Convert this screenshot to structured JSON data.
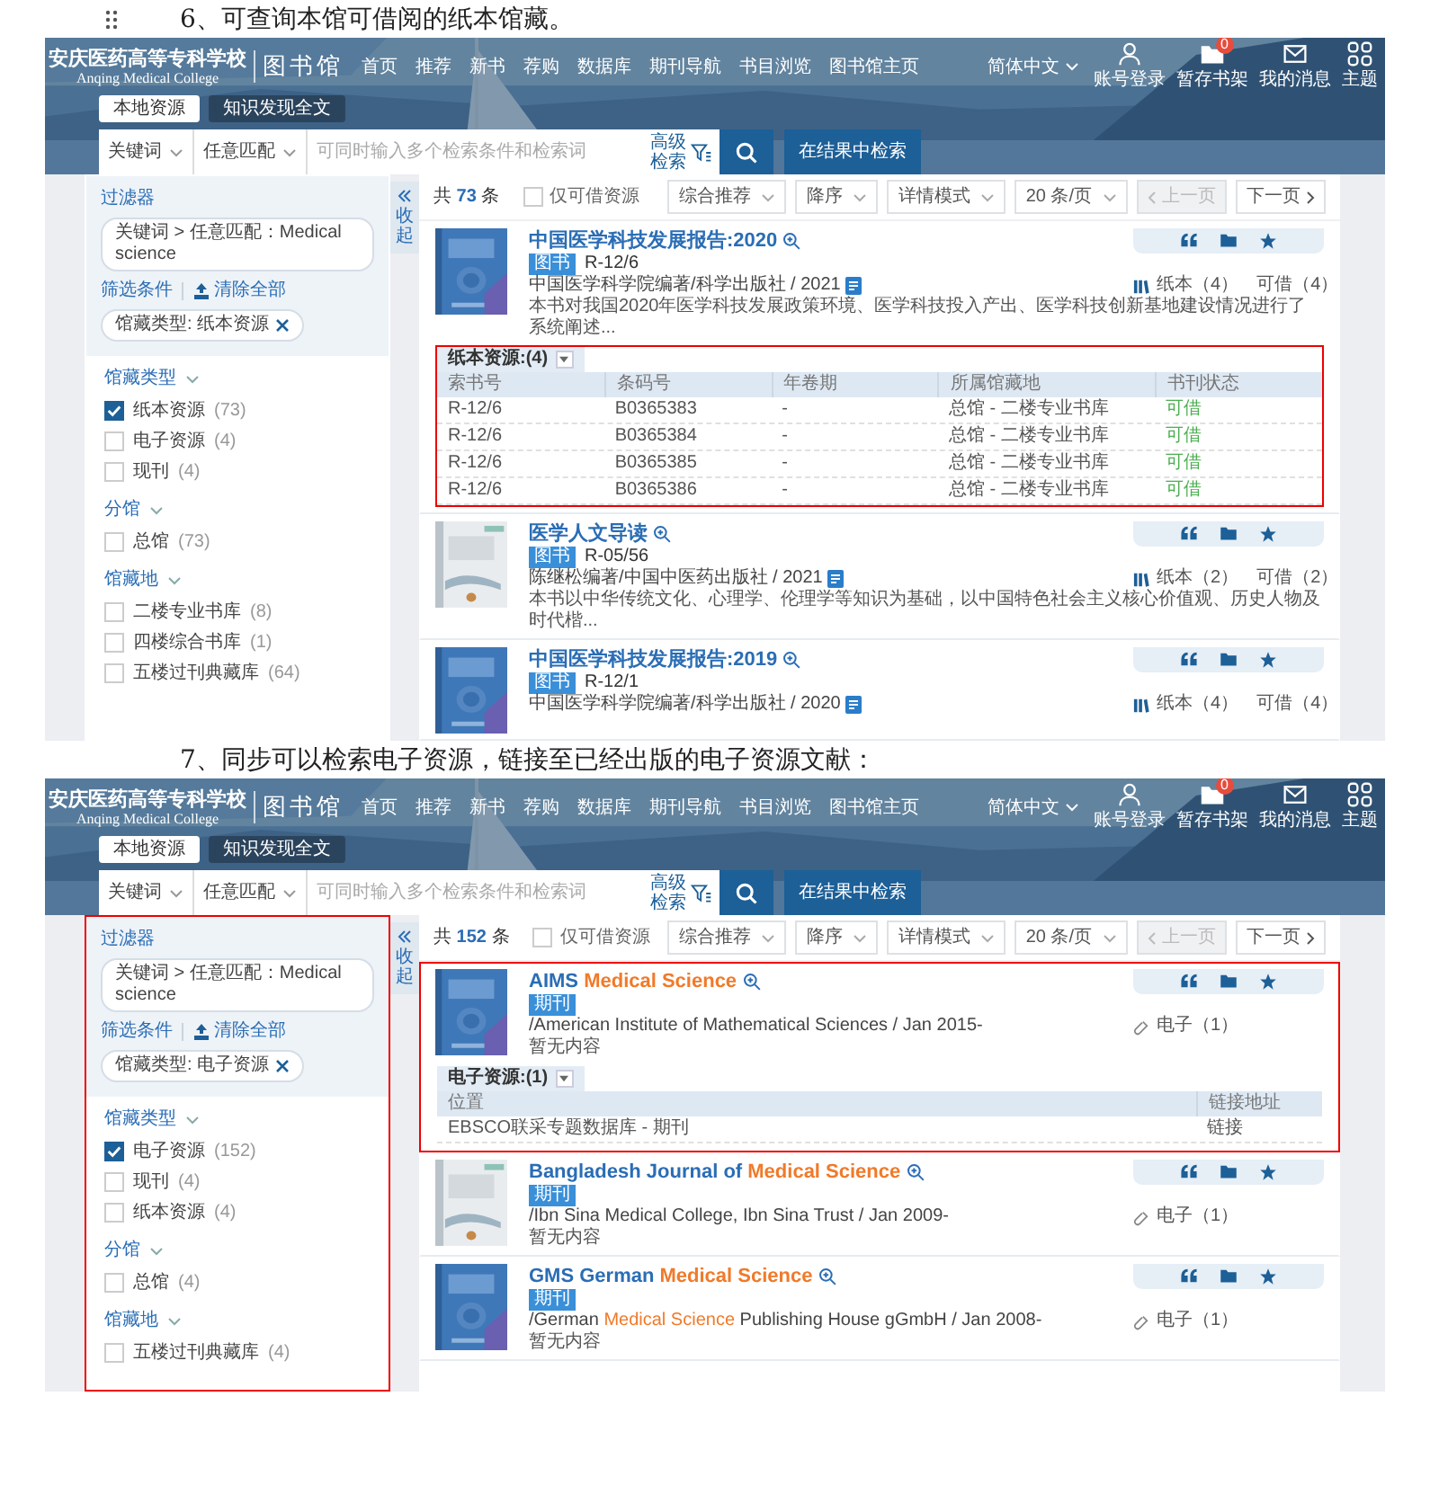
{
  "steps": [
    {
      "caption": "6、可查询本馆可借阅的纸本馆藏。",
      "drag_handle": true,
      "screen": {
        "logo": {
          "name": "安庆医药高等专科学校",
          "subtitle": "Anqing Medical College",
          "library": "图书馆"
        },
        "nav": [
          "首页",
          "推荐",
          "新书",
          "荐购",
          "数据库",
          "期刊导航",
          "书目浏览",
          "图书馆主页"
        ],
        "language": "简体中文",
        "header_actions": [
          {
            "kind": "user",
            "label": "账号登录"
          },
          {
            "kind": "shelf",
            "label": "暂存书架",
            "badge": "0"
          },
          {
            "kind": "message",
            "label": "我的消息"
          },
          {
            "kind": "theme",
            "label": "主题"
          }
        ],
        "search_tabs": [
          {
            "label": "本地资源",
            "selected": true
          },
          {
            "label": "知识发现全文",
            "selected": false
          }
        ],
        "search": {
          "field": "关键词",
          "match": "任意匹配",
          "placeholder": "可同时输入多个检索条件和检索词",
          "advanced": "高级检索",
          "refine": "在结果中检索"
        },
        "filter_panel": {
          "highlighted": false,
          "title": "过滤器",
          "query_chip": "关键词 > 任意匹配：Medical science",
          "conditions_label": "筛选条件",
          "clear_label": "清除全部",
          "active_chips": [
            "馆藏类型: 纸本资源"
          ],
          "collapse_label": "收起",
          "facets": [
            {
              "title": "馆藏类型",
              "items": [
                {
                  "label": "纸本资源",
                  "count": "(73)",
                  "checked": true
                },
                {
                  "label": "电子资源",
                  "count": "(4)",
                  "checked": false
                },
                {
                  "label": "现刊",
                  "count": "(4)",
                  "checked": false
                }
              ]
            },
            {
              "title": "分馆",
              "items": [
                {
                  "label": "总馆",
                  "count": "(73)",
                  "checked": false
                }
              ]
            },
            {
              "title": "馆藏地",
              "items": [
                {
                  "label": "二楼专业书库",
                  "count": "(8)",
                  "checked": false
                },
                {
                  "label": "四楼综合书库",
                  "count": "(1)",
                  "checked": false
                },
                {
                  "label": "五楼过刊典藏库",
                  "count": "(64)",
                  "checked": false
                }
              ]
            }
          ]
        },
        "results": {
          "total_prefix": "共",
          "total": "73",
          "total_suffix": "条",
          "available_only": {
            "label": "仅可借资源",
            "checked": false
          },
          "sorts": [
            "综合推荐",
            "降序",
            "详情模式",
            "20 条/页"
          ],
          "prev": {
            "label": "上一页",
            "disabled": true
          },
          "next": {
            "label": "下一页",
            "disabled": false
          },
          "items": [
            {
              "highlighted": false,
              "title": [
                {
                  "text": "中国医学科技发展报告:2020",
                  "highlight": false
                }
              ],
              "type_tag": "图书",
              "call_number": "R-12/6",
              "publisher": [
                {
                  "text": "中国医学科学院编著/科学出版社 / 2021",
                  "highlight": false
                }
              ],
              "ebook_icon": true,
              "summary": "本书对我国2020年医学科技发展政策环境、医学科技投入产出、医学科技创新基地建设情况进行了系统阐述...",
              "holdings": [
                {
                  "kind": "print",
                  "label": "纸本（4）"
                },
                {
                  "kind": "available",
                  "label": "可借（4）"
                }
              ],
              "table": {
                "highlighted": true,
                "label": "纸本资源:(4)",
                "columns": [
                  {
                    "label": "索书号",
                    "kind": "text"
                  },
                  {
                    "label": "条码号",
                    "kind": "text"
                  },
                  {
                    "label": "年卷期",
                    "kind": "text"
                  },
                  {
                    "label": "所属馆藏地",
                    "kind": "wide"
                  },
                  {
                    "label": "书刊状态",
                    "kind": "status"
                  }
                ],
                "rows": [
                  [
                    "R-12/6",
                    "B0365383",
                    "-",
                    "总馆 - 二楼专业书库",
                    "可借"
                  ],
                  [
                    "R-12/6",
                    "B0365384",
                    "-",
                    "总馆 - 二楼专业书库",
                    "可借"
                  ],
                  [
                    "R-12/6",
                    "B0365385",
                    "-",
                    "总馆 - 二楼专业书库",
                    "可借"
                  ],
                  [
                    "R-12/6",
                    "B0365386",
                    "-",
                    "总馆 - 二楼专业书库",
                    "可借"
                  ]
                ]
              }
            },
            {
              "highlighted": false,
              "title": [
                {
                  "text": "医学人文导读",
                  "highlight": false
                }
              ],
              "type_tag": "图书",
              "call_number": "R-05/56",
              "publisher": [
                {
                  "text": "陈继松编著/中国中医药出版社 / 2021",
                  "highlight": false
                }
              ],
              "ebook_icon": true,
              "summary": "本书以中华传统文化、心理学、伦理学等知识为基础，以中国特色社会主义核心价值观、历史人物及时代楷...",
              "holdings": [
                {
                  "kind": "print",
                  "label": "纸本（2）"
                },
                {
                  "kind": "available",
                  "label": "可借（2）"
                }
              ]
            },
            {
              "highlighted": false,
              "title": [
                {
                  "text": "中国医学科技发展报告:2019",
                  "highlight": false
                }
              ],
              "type_tag": "图书",
              "call_number": "R-12/1",
              "publisher": [
                {
                  "text": "中国医学科学院编著/科学出版社 / 2020",
                  "highlight": false
                }
              ],
              "ebook_icon": true,
              "holdings": [
                {
                  "kind": "print",
                  "label": "纸本（4）"
                },
                {
                  "kind": "available",
                  "label": "可借（4）"
                }
              ]
            }
          ]
        }
      }
    },
    {
      "caption": "7、同步可以检索电子资源，链接至已经出版的电子资源文献：",
      "drag_handle": false,
      "screen": {
        "logo": {
          "name": "安庆医药高等专科学校",
          "subtitle": "Anqing Medical College",
          "library": "图书馆"
        },
        "nav": [
          "首页",
          "推荐",
          "新书",
          "荐购",
          "数据库",
          "期刊导航",
          "书目浏览",
          "图书馆主页"
        ],
        "language": "简体中文",
        "header_actions": [
          {
            "kind": "user",
            "label": "账号登录"
          },
          {
            "kind": "shelf",
            "label": "暂存书架",
            "badge": "0"
          },
          {
            "kind": "message",
            "label": "我的消息"
          },
          {
            "kind": "theme",
            "label": "主题"
          }
        ],
        "search_tabs": [
          {
            "label": "本地资源",
            "selected": true
          },
          {
            "label": "知识发现全文",
            "selected": false
          }
        ],
        "search": {
          "field": "关键词",
          "match": "任意匹配",
          "placeholder": "可同时输入多个检索条件和检索词",
          "advanced": "高级检索",
          "refine": "在结果中检索"
        },
        "filter_panel": {
          "highlighted": true,
          "title": "过滤器",
          "query_chip": "关键词 > 任意匹配：Medical science",
          "conditions_label": "筛选条件",
          "clear_label": "清除全部",
          "active_chips": [
            "馆藏类型: 电子资源"
          ],
          "collapse_label": "收起",
          "facets": [
            {
              "title": "馆藏类型",
              "items": [
                {
                  "label": "电子资源",
                  "count": "(152)",
                  "checked": true
                },
                {
                  "label": "现刊",
                  "count": "(4)",
                  "checked": false
                },
                {
                  "label": "纸本资源",
                  "count": "(4)",
                  "checked": false
                }
              ]
            },
            {
              "title": "分馆",
              "items": [
                {
                  "label": "总馆",
                  "count": "(4)",
                  "checked": false
                }
              ]
            },
            {
              "title": "馆藏地",
              "items": [
                {
                  "label": "五楼过刊典藏库",
                  "count": "(4)",
                  "checked": false
                }
              ]
            }
          ]
        },
        "results": {
          "total_prefix": "共",
          "total": "152",
          "total_suffix": "条",
          "available_only": {
            "label": "仅可借资源",
            "checked": false
          },
          "sorts": [
            "综合推荐",
            "降序",
            "详情模式",
            "20 条/页"
          ],
          "prev": {
            "label": "上一页",
            "disabled": true
          },
          "next": {
            "label": "下一页",
            "disabled": false
          },
          "items": [
            {
              "highlighted": true,
              "title": [
                {
                  "text": "AIMS ",
                  "highlight": false
                },
                {
                  "text": "Medical Science",
                  "highlight": true
                }
              ],
              "type_tag": "期刊",
              "ebook_icon": false,
              "publisher": [
                {
                  "text": "/American Institute of Mathematical Sciences / Jan 2015-",
                  "highlight": false
                }
              ],
              "summary": "暂无内容",
              "holdings": [
                {
                  "kind": "electronic",
                  "label": "电子（1）"
                }
              ],
              "table": {
                "highlighted": false,
                "label": "电子资源:(1)",
                "columns": [
                  {
                    "label": "位置",
                    "kind": "text"
                  },
                  {
                    "label": "链接地址",
                    "kind": "link"
                  }
                ],
                "rows": [
                  [
                    "EBSCO联采专题数据库 - 期刊",
                    "链接"
                  ]
                ]
              }
            },
            {
              "highlighted": false,
              "title": [
                {
                  "text": "Bangladesh Journal of ",
                  "highlight": false
                },
                {
                  "text": "Medical Science",
                  "highlight": true
                }
              ],
              "type_tag": "期刊",
              "ebook_icon": false,
              "publisher": [
                {
                  "text": "/Ibn Sina Medical College, Ibn Sina Trust / Jan 2009-",
                  "highlight": false
                }
              ],
              "summary": "暂无内容",
              "holdings": [
                {
                  "kind": "electronic",
                  "label": "电子（1）"
                }
              ]
            },
            {
              "highlighted": false,
              "title": [
                {
                  "text": "GMS German ",
                  "highlight": false
                },
                {
                  "text": "Medical Science",
                  "highlight": true
                }
              ],
              "type_tag": "期刊",
              "ebook_icon": false,
              "publisher": [
                {
                  "text": "/German ",
                  "highlight": false
                },
                {
                  "text": "Medical Science",
                  "highlight": true
                },
                {
                  "text": " Publishing House gGmbH / Jan 2008-",
                  "highlight": false
                }
              ],
              "summary": "暂无内容",
              "holdings": [
                {
                  "kind": "electronic",
                  "label": "电子（1）"
                }
              ]
            }
          ]
        }
      }
    }
  ]
}
